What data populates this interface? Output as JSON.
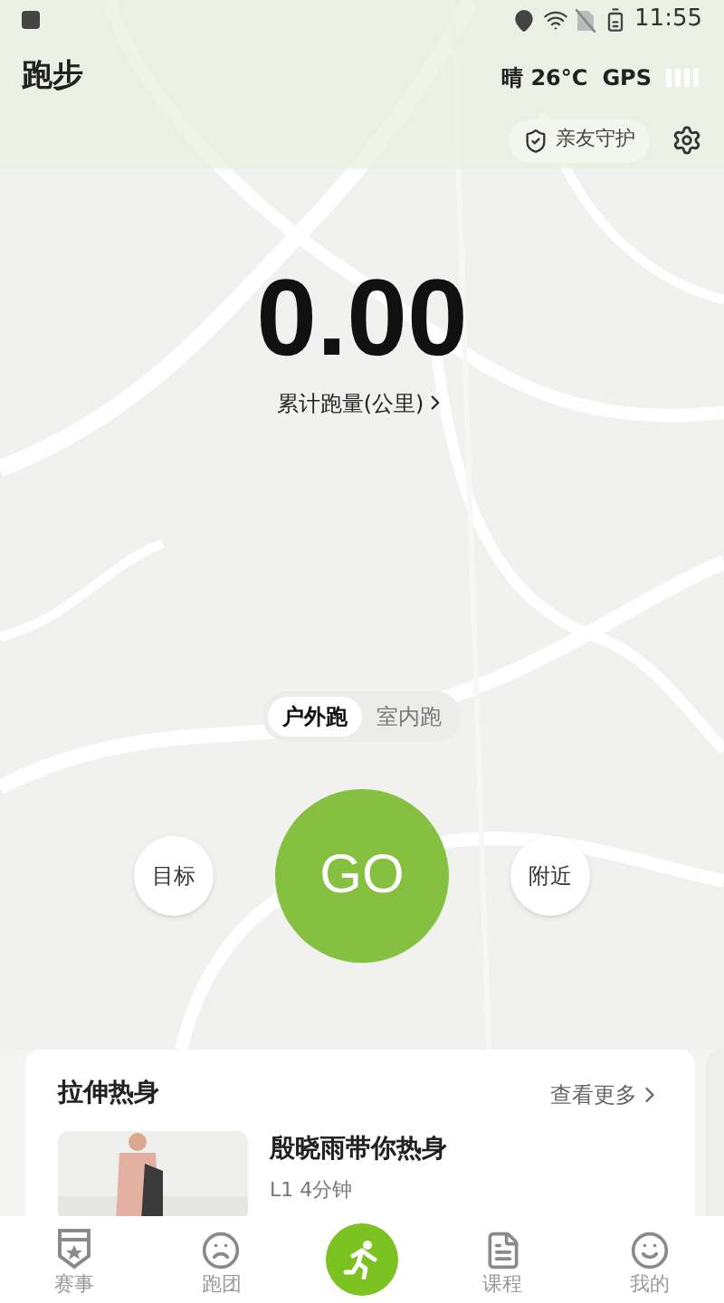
{
  "status_bar": {
    "time": "11:55"
  },
  "header": {
    "title": "跑步",
    "weather": "晴 26°C",
    "gps_label": "GPS",
    "guard_button": "亲友守护"
  },
  "distance": {
    "value": "0.00",
    "label": "累计跑量(公里)"
  },
  "modes": [
    {
      "label": "户外跑",
      "selected": true
    },
    {
      "label": "室内跑",
      "selected": false
    }
  ],
  "actions": {
    "left": "目标",
    "go": "GO",
    "right": "附近"
  },
  "warmup": {
    "title": "拉伸热身",
    "more": "查看更多",
    "items": [
      {
        "title": "殷晓雨带你热身",
        "meta": "L1 4分钟"
      }
    ]
  },
  "tabs": [
    {
      "kind": "event",
      "label": "赛事"
    },
    {
      "kind": "club",
      "label": "跑团"
    },
    {
      "kind": "run"
    },
    {
      "kind": "course",
      "label": "课程"
    },
    {
      "kind": "profile",
      "label": "我的"
    }
  ]
}
